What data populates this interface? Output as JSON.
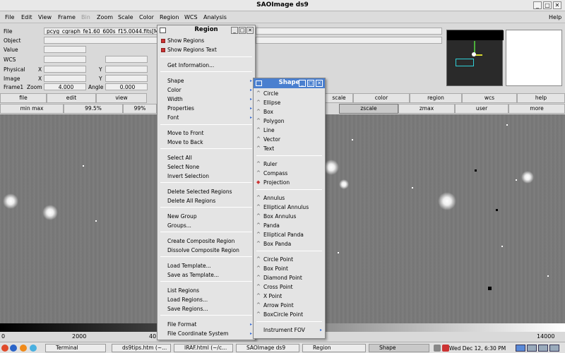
{
  "window": {
    "title": "SAOImage ds9",
    "minimize": "_",
    "maximize": "□",
    "close": "✕"
  },
  "menubar": [
    "File",
    "Edit",
    "View",
    "Frame",
    "Bin",
    "Zoom",
    "Scale",
    "Color",
    "Region",
    "WCS",
    "Analysis",
    "Help"
  ],
  "info": {
    "file_label": "File",
    "file_value": "pcyg_cgraph_fe1.60_600s_f15.0044.fits[M",
    "object_label": "Object",
    "value_label": "Value",
    "wcs_label": "WCS",
    "physical_label": "Physical",
    "image_label": "Image",
    "x_label": "X",
    "y_label": "Y",
    "frame_label": "Frame1",
    "zoom_label": "Zoom",
    "zoom_value": "4.000",
    "angle_label": "Angle",
    "angle_value": "0.000"
  },
  "buttonbar1": [
    "file",
    "edit",
    "view",
    "scale",
    "color",
    "region",
    "wcs",
    "help"
  ],
  "buttonbar2": [
    "min max",
    "99.5%",
    "99%",
    "zscale",
    "zmax",
    "user",
    "more"
  ],
  "colorbar_ticks": [
    "0",
    "2000",
    "40",
    "14000"
  ],
  "region_menu": {
    "title": "Region",
    "show_regions": "Show Regions",
    "show_regions_text": "Show Regions Text",
    "get_information": "Get Information...",
    "shape": "Shape",
    "color": "Color",
    "width": "Width",
    "properties": "Properties",
    "font": "Font",
    "move_front": "Move to Front",
    "move_back": "Move to Back",
    "select_all": "Select All",
    "select_none": "Select None",
    "invert_selection": "Invert Selection",
    "delete_selected": "Delete Selected Regions",
    "delete_all": "Delete All Regions",
    "new_group": "New Group",
    "groups": "Groups...",
    "create_composite": "Create Composite Region",
    "dissolve_composite": "Dissolve Composite Region",
    "load_template": "Load Template...",
    "save_template": "Save as Template...",
    "list_regions": "List Regions",
    "load_regions": "Load Regions...",
    "save_regions": "Save Regions...",
    "file_format": "File Format",
    "file_coord": "File Coordinate System"
  },
  "shape_menu": {
    "title": "Shape",
    "items1": [
      "Circle",
      "Ellipse",
      "Box",
      "Polygon",
      "Line",
      "Vector",
      "Text"
    ],
    "items2": [
      "Ruler",
      "Compass",
      "Projection"
    ],
    "items3": [
      "Annulus",
      "Elliptical Annulus",
      "Box Annulus",
      "Panda",
      "Elliptical Panda",
      "Box Panda"
    ],
    "items4": [
      "Circle Point",
      "Box Point",
      "Diamond Point",
      "Cross Point",
      "X Point",
      "Arrow Point",
      "BoxCircle Point"
    ],
    "items5": [
      "Instrument FOV"
    ]
  },
  "taskbar": {
    "terminal": "Terminal",
    "ds9tips": "ds9tips.htm (~...",
    "iraf": "IRAF.html (~/c...",
    "saoimage": "SAOImage ds9",
    "region": "Region",
    "shape": "Shape",
    "clock": "Wed Dec 12,  6:30 PM"
  }
}
